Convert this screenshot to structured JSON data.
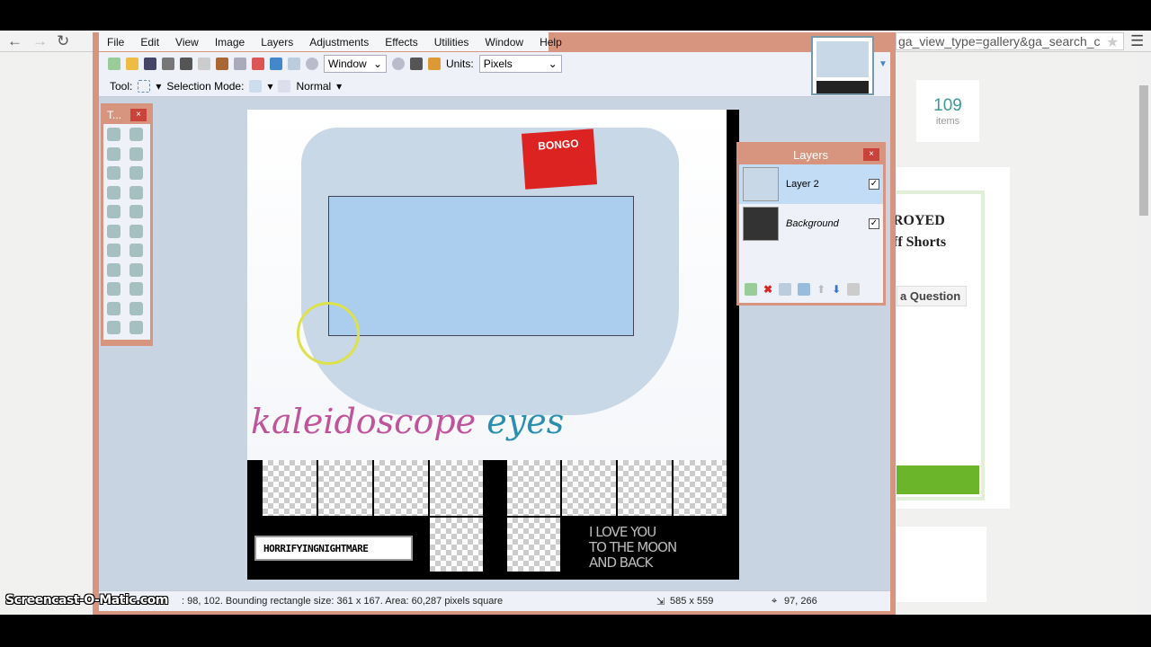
{
  "browser": {
    "url": "ga_view_type=gallery&ga_search_c",
    "back_icon": "arrow-left",
    "forward_icon": "arrow-right",
    "reload_icon": "reload",
    "star_icon": "star",
    "menu_icon": "hamburger"
  },
  "app": {
    "menu": [
      "File",
      "Edit",
      "View",
      "Image",
      "Layers",
      "Adjustments",
      "Effects",
      "Utilities",
      "Window",
      "Help"
    ],
    "toolbar": {
      "zoom_select": "Window",
      "units_label": "Units:",
      "units_select": "Pixels"
    },
    "toolbar2": {
      "tool_label": "Tool:",
      "selection_mode_label": "Selection Mode:",
      "blend_mode": "Normal"
    },
    "tools_panel": {
      "title": "T...",
      "close": "×"
    },
    "layers_panel": {
      "title": "Layers",
      "close": "×",
      "layers": [
        {
          "name": "Layer 2",
          "visible": true,
          "selected": true
        },
        {
          "name": "Background",
          "visible": true,
          "selected": false
        }
      ]
    },
    "status": {
      "selection_info": ": 98, 102. Bounding rectangle size: 361 x 167. Area: 60,287 pixels square",
      "image_size": "585 x 559",
      "cursor_pos": "97, 266"
    },
    "canvas": {
      "tag_text": "BONGO",
      "script_text_1": "kaleidoscope",
      "script_text_2": "eyes",
      "badge_text": "HORRIFYINGNIGHTMARE",
      "love_text": [
        "I LOVE YOU",
        "TO THE MOON",
        "AND BACK"
      ]
    }
  },
  "watermark": "Screencast-O-Matic.com",
  "page": {
    "items_count": "109",
    "items_label": "items",
    "product_title": "ROYED\nff Shorts",
    "ask_button": "a Question"
  },
  "colors": {
    "window_border": "#d7957f",
    "canvas_bg": "#c9d4e3",
    "accent_green": "#6bb52b"
  }
}
